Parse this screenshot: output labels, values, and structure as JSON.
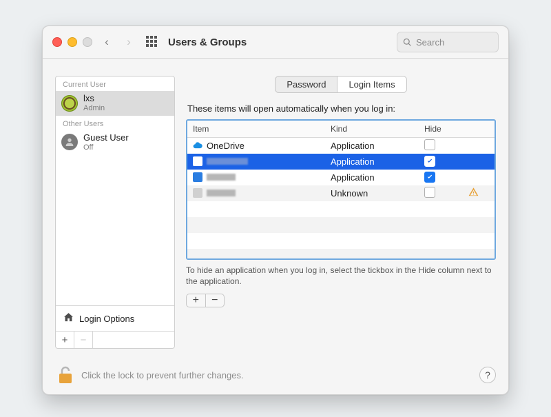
{
  "titlebar": {
    "title": "Users & Groups",
    "search_placeholder": "Search"
  },
  "sidebar": {
    "current_label": "Current User",
    "other_label": "Other Users",
    "users": [
      {
        "name": "lxs",
        "sub": "Admin"
      },
      {
        "name": "Guest User",
        "sub": "Off"
      }
    ],
    "login_options": "Login Options"
  },
  "tabs": {
    "password": "Password",
    "login_items": "Login Items"
  },
  "main": {
    "desc": "These items will open automatically when you log in:",
    "headers": {
      "item": "Item",
      "kind": "Kind",
      "hide": "Hide"
    },
    "rows": [
      {
        "item": "OneDrive",
        "kind": "Application",
        "hide": false,
        "warn": false,
        "icon": "cloud"
      },
      {
        "item": "blurred",
        "kind": "Application",
        "hide": true,
        "warn": false
      },
      {
        "item": "blurred",
        "kind": "Application",
        "hide": true,
        "warn": false
      },
      {
        "item": "blurred",
        "kind": "Unknown",
        "hide": false,
        "warn": true
      }
    ],
    "hint": "To hide an application when you log in, select the tickbox in the Hide column next to the application."
  },
  "footer": {
    "lock_text": "Click the lock to prevent further changes.",
    "help": "?"
  }
}
